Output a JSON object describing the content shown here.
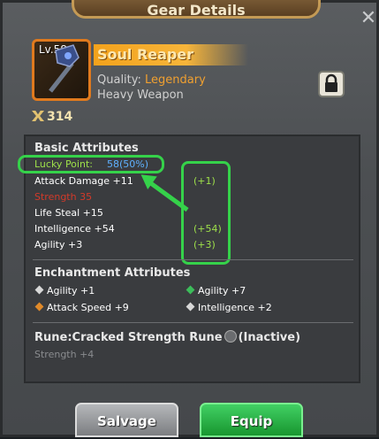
{
  "window": {
    "title": "Gear Details",
    "close_icon": "close-icon"
  },
  "item": {
    "level": "Lv.58",
    "name": "Soul Reaper",
    "quality_label": "Quality:",
    "quality_value": "Legendary",
    "type": "Heavy Weapon",
    "power": "314",
    "icon": "hammer-weapon-icon",
    "lock_icon": "lock-icon"
  },
  "basic": {
    "title": "Basic Attributes",
    "lucky_label": "Lucky Point:",
    "lucky_value": "58(50%)",
    "attrs": [
      {
        "text": "Attack Damage +11",
        "bonus": "(+1)"
      },
      {
        "text": "Strength  35",
        "bonus": ""
      },
      {
        "text": "Life Steal +15",
        "bonus": ""
      },
      {
        "text": "Intelligence +54",
        "bonus": "(+54)"
      },
      {
        "text": "Agility +3",
        "bonus": "(+3)"
      }
    ]
  },
  "enchant": {
    "title": "Enchantment Attributes",
    "left": [
      "Agility +1",
      "Attack Speed +9"
    ],
    "right": [
      "Agility +7",
      "Intelligence +2"
    ]
  },
  "rune": {
    "title": "Rune:Cracked Strength Rune",
    "status": "(Inactive)",
    "attr": "Strength +4"
  },
  "buttons": {
    "salvage": "Salvage",
    "equip": "Equip"
  },
  "colors": {
    "highlight": "#35d24a",
    "legendary": "#f0a030",
    "lucky_value": "#5fb0ff"
  }
}
